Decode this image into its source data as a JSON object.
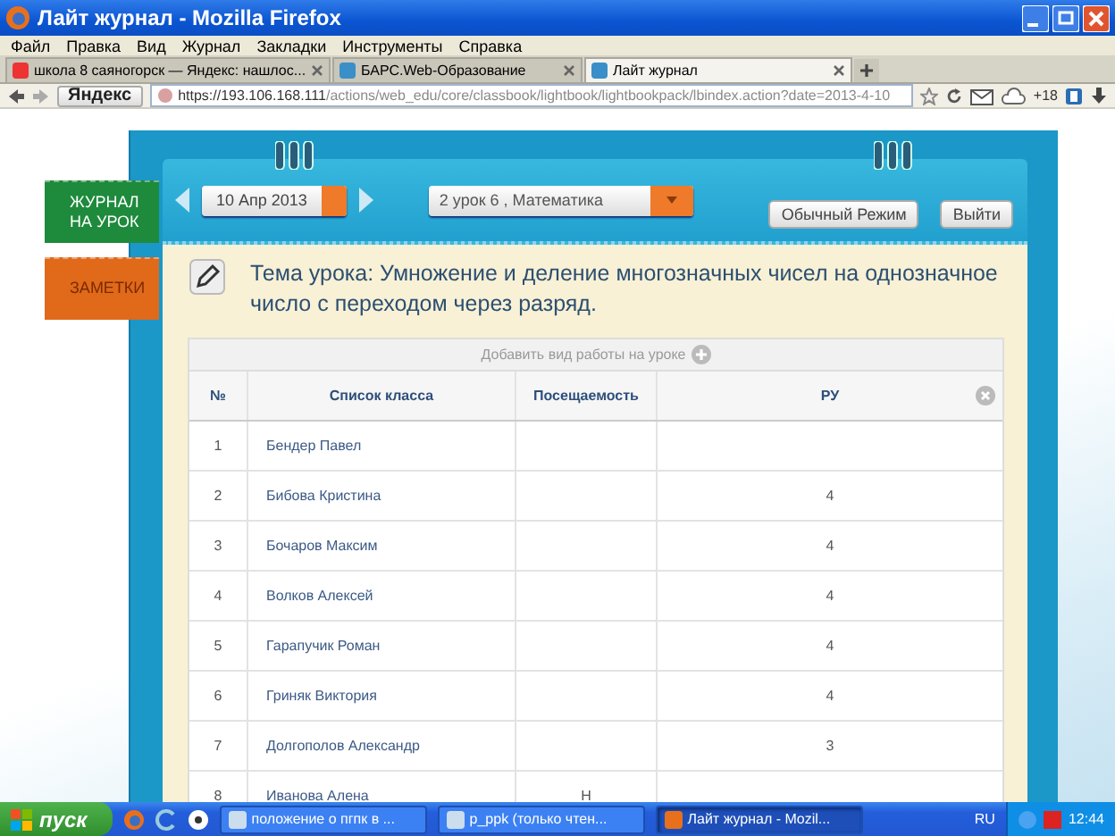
{
  "window": {
    "title": "Лайт журнал - Mozilla Firefox"
  },
  "menu": [
    "Файл",
    "Правка",
    "Вид",
    "Журнал",
    "Закладки",
    "Инструменты",
    "Справка"
  ],
  "tabs": [
    {
      "label": "школа 8 саяногорск — Яндекс: нашлос...",
      "selected": false
    },
    {
      "label": "БАРС.Web-Образование",
      "selected": false
    },
    {
      "label": "Лайт журнал",
      "selected": true
    }
  ],
  "navbar": {
    "yandex": "Яндекс",
    "url_host": "https://193.106.168.111",
    "url_path": "/actions/web_edu/core/classbook/lightbook/lightbookpack/lbindex.action?date=2013-4-10",
    "badge": "+18"
  },
  "side_tabs": [
    {
      "label": "ЖУРНАЛ НА УРОК",
      "color": "#1e8a3c"
    },
    {
      "label": "ЗАМЕТКИ",
      "color": "#e0691a"
    }
  ],
  "header": {
    "date": "10 Апр 2013",
    "lesson": "2 урок 6 , Математика",
    "buttons": [
      "Обычный Режим",
      "Выйти"
    ]
  },
  "topic": "Тема урока: Умножение и деление многозначных чисел на однозначное число с переходом через разряд.",
  "add_work": "Добавить вид работы на уроке",
  "table": {
    "columns": [
      "№",
      "Список класса",
      "Посещаемость",
      "РУ"
    ],
    "rows": [
      {
        "num": "1",
        "name": "Бендер Павел",
        "attendance": "",
        "grade": ""
      },
      {
        "num": "2",
        "name": "Бибова Кристина",
        "attendance": "",
        "grade": "4"
      },
      {
        "num": "3",
        "name": "Бочаров Максим",
        "attendance": "",
        "grade": "4"
      },
      {
        "num": "4",
        "name": "Волков Алексей",
        "attendance": "",
        "grade": "4"
      },
      {
        "num": "5",
        "name": "Гарапучик Роман",
        "attendance": "",
        "grade": "4"
      },
      {
        "num": "6",
        "name": "Гриняк Виктория",
        "attendance": "",
        "grade": "4"
      },
      {
        "num": "7",
        "name": "Долгополов Александр",
        "attendance": "",
        "grade": "3"
      },
      {
        "num": "8",
        "name": "Иванова Алена",
        "attendance": "Н",
        "grade": ""
      }
    ]
  },
  "taskbar": {
    "start": "пуск",
    "tasks": [
      {
        "label": "положение о пгпк в ...",
        "selected": false
      },
      {
        "label": "p_ppk (только чтен...",
        "selected": false
      },
      {
        "label": "Лайт журнал - Mozil...",
        "selected": true
      }
    ],
    "lang": "RU",
    "clock": "12:44"
  }
}
